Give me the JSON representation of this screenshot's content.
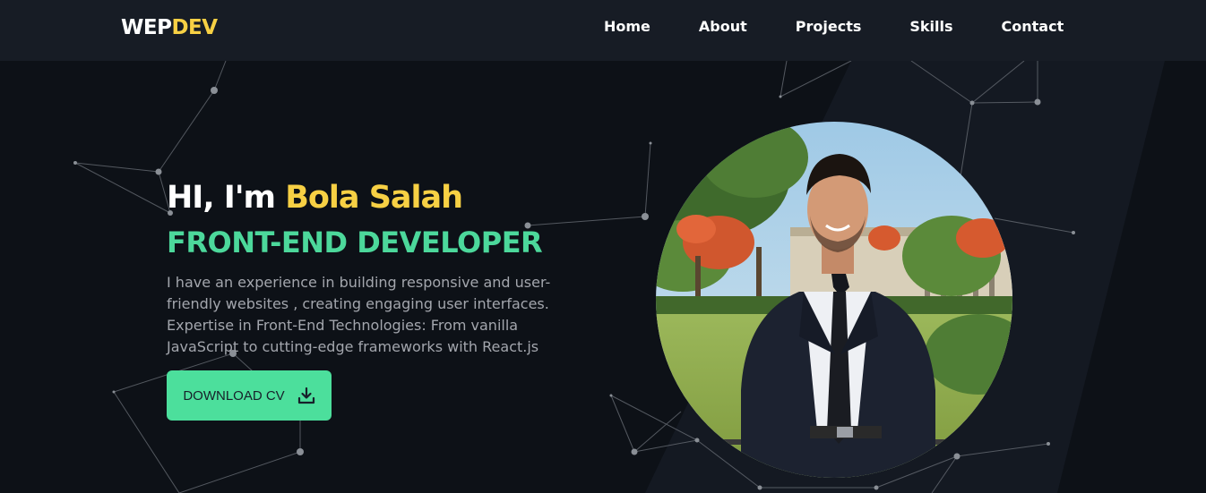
{
  "header": {
    "logo_part1": "WEP",
    "logo_part2": "DEV",
    "nav": [
      {
        "label": "Home"
      },
      {
        "label": "About"
      },
      {
        "label": "Projects"
      },
      {
        "label": "Skills"
      },
      {
        "label": "Contact"
      }
    ]
  },
  "hero": {
    "greeting_prefix": "HI, I'm ",
    "name": "Bola Salah",
    "role": "FRONT-END DEVELOPER",
    "bio_lines": [
      "I have an experience in building responsive and user-",
      "friendly websites , creating engaging user interfaces.",
      "Expertise in Front-End Technologies: From vanilla",
      "JavaScript to cutting-edge frameworks with React.js"
    ],
    "cta_label": "DOWNLOAD CV"
  },
  "colors": {
    "background": "#0d1117",
    "navbar": "#171c25",
    "accent_yellow": "#f7d044",
    "accent_green": "#4cd89b",
    "button": "#4cdf9c"
  },
  "icons": {
    "cta_icon": "download-icon",
    "avatar": "profile-photo"
  }
}
